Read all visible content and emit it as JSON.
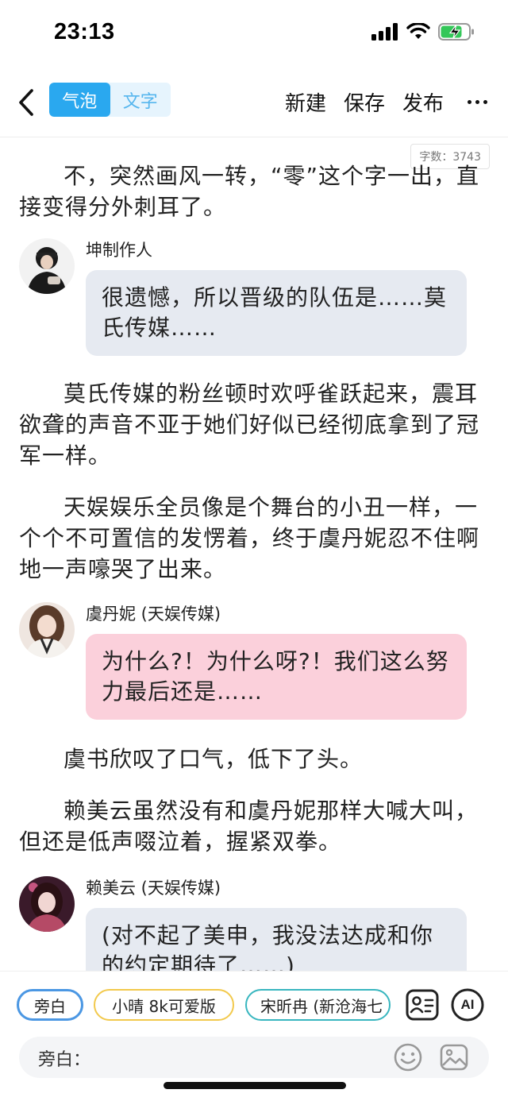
{
  "status_bar": {
    "time": "23:13"
  },
  "nav": {
    "mode_bubble": "气泡",
    "mode_text": "文字",
    "new_label": "新建",
    "save_label": "保存",
    "publish_label": "发布"
  },
  "word_count": "字数：3743",
  "story": {
    "p1": "不，突然画风一转，“零”这个字一出，直接变得分外刺耳了。",
    "d1_speaker": "坤制作人",
    "d1_text": "很遗憾，所以晋级的队伍是……莫氏传媒……",
    "p2": "莫氏传媒的粉丝顿时欢呼雀跃起来，震耳欲聋的声音不亚于她们好似已经彻底拿到了冠军一样。",
    "p3": "天娱娱乐全员像是个舞台的小丑一样，一个个不可置信的发愣着，终于虞丹妮忍不住啊地一声嚎哭了出来。",
    "d2_speaker": "虞丹妮 (天娱传媒)",
    "d2_text": "为什么?！为什么呀?！我们这么努力最后还是……",
    "p4": "虞书欣叹了口气，低下了头。",
    "p5": "赖美云虽然没有和虞丹妮那样大喊大叫，但还是低声啜泣着，握紧双拳。",
    "d3_speaker": "赖美云 (天娱传媒)",
    "d3_text": "(对不起了美申，我没法达成和你的约定期待了……)"
  },
  "bottom": {
    "chips": [
      "旁白",
      "小晴 8k可爱版",
      "宋昕冉 (新沧海七"
    ],
    "ai_label": "AI",
    "input_label": "旁白：",
    "input_value": ""
  }
}
